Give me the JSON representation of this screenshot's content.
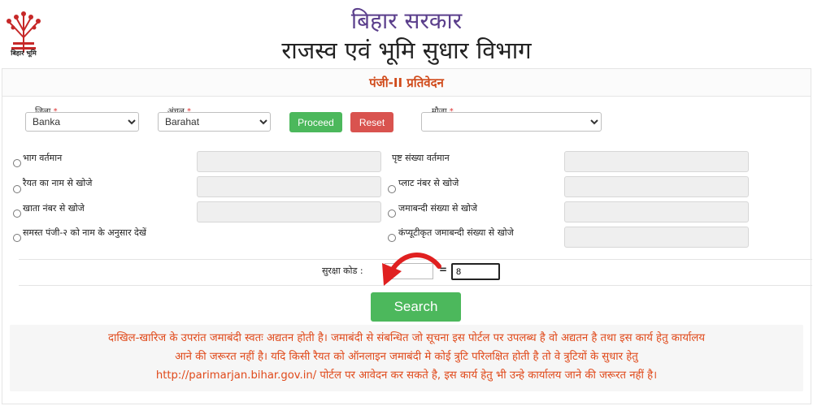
{
  "header": {
    "logo_text": "बिहार भूमि",
    "title_line1": "बिहार सरकार",
    "title_line2": "राजस्व एवं भूमि सुधार विभाग"
  },
  "panel": {
    "title": "पंजी-II प्रतिवेदन"
  },
  "filters": {
    "district_label": "जिला",
    "district_value": "Banka",
    "circle_label": "अंचल",
    "circle_value": "Barahat",
    "mauza_label": "मौजा",
    "mauza_value": "",
    "required_mark": "*",
    "proceed_label": "Proceed",
    "reset_label": "Reset"
  },
  "search_options": {
    "left": [
      "भाग वर्तमान",
      "रैयत का नाम से खोजे",
      "खाता नंबर से खोजे",
      "समस्त पंजी-२ को नाम के अनुसार देखें"
    ],
    "right": [
      "पृष्ट संख्या वर्तमान",
      "प्लाट नंबर से खोजे",
      "जमाबन्दी संख्या से खोजे",
      "कंप्यूटीकृत जमाबन्दी संख्या से खोजे"
    ]
  },
  "captcha": {
    "label": "सुरक्षा कोड :",
    "equals": "=",
    "input_value": "8"
  },
  "search_button": "Search",
  "notice": {
    "line1": "दाखिल-खारिज के उपरांत जमाबंदी स्वतः अद्यतन होती है। जमाबंदी से संबन्धित जो सूचना इस पोर्टल पर उपलब्ध है वो अद्यतन है तथा इस कार्य हेतु कार्यालय",
    "line2": "आने की जरूरत नहीं है। यदि किसी रैयत को ऑनलाइन जमाबंदी मे कोई त्रुटि परिलक्षित होती है तो वे त्रुटियों के सुधार हेतु",
    "line3": "http://parimarjan.bihar.gov.in/ पोर्टल पर आवेदन कर सकते है, इस कार्य हेतु भी उन्हे कार्यालय जाने की जरूरत नहीं है।"
  },
  "colors": {
    "title_purple": "#5b3f8c",
    "panel_title_orange": "#d04a1a",
    "notice_orange": "#e04a1b",
    "button_green": "#4cb85c",
    "button_red": "#d9534f",
    "arrow_red": "#e02020"
  },
  "icons": {
    "logo": "bihar-tree-logo-icon",
    "select_arrow": "chevron-down-icon",
    "annotation": "curved-arrow-icon"
  }
}
